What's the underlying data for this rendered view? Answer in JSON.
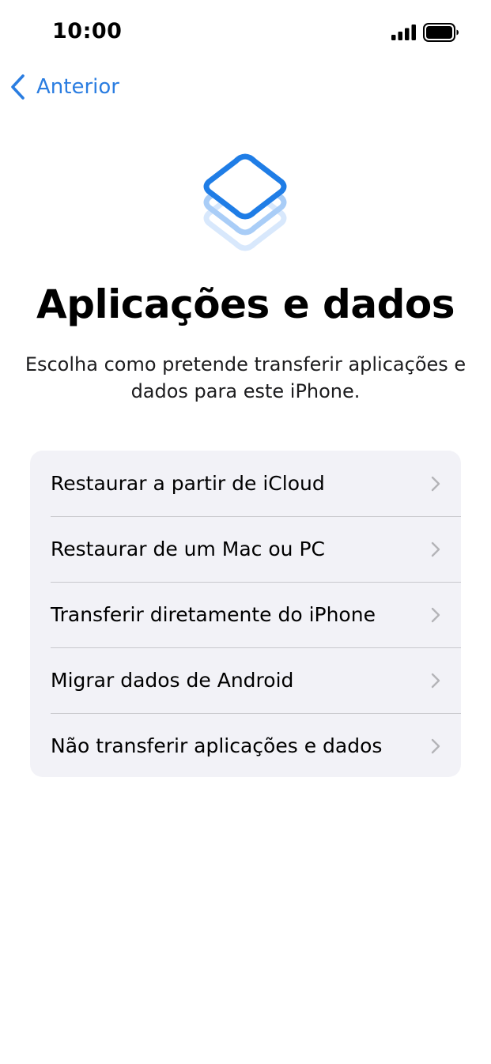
{
  "status_bar": {
    "time": "10:00",
    "signal_icon": "cellular-signal-icon",
    "battery_icon": "battery-full-icon"
  },
  "nav": {
    "back_label": "Anterior",
    "back_icon": "chevron-left-icon"
  },
  "hero": {
    "icon": "stacked-layers-icon"
  },
  "header": {
    "title": "Aplicações e dados",
    "subtitle": "Escolha como pretende transferir aplicações e dados para este iPhone."
  },
  "options": [
    {
      "label": "Restaurar a partir de iCloud"
    },
    {
      "label": "Restaurar de um Mac ou PC"
    },
    {
      "label": "Transferir diretamente do iPhone"
    },
    {
      "label": "Migrar dados de Android"
    },
    {
      "label": "Não transferir aplicações e dados"
    }
  ],
  "colors": {
    "accent": "#2a7de1",
    "list_background": "#f2f2f7",
    "separator": "#c8c8cc",
    "chevron": "#b4b4b8"
  }
}
